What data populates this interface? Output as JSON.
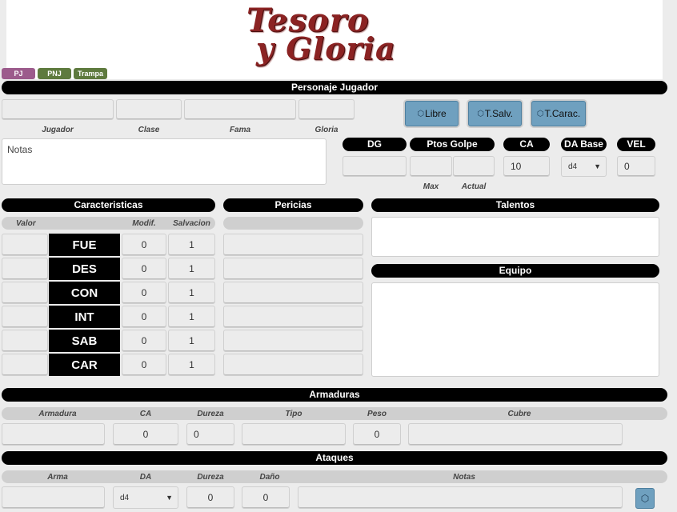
{
  "logo": {
    "line1": "Tesoro",
    "line2": "y Gloria"
  },
  "tabs": [
    {
      "label": "PJ",
      "color": "#9c5b8c"
    },
    {
      "label": "PNJ",
      "color": "#5e7a3e"
    },
    {
      "label": "Trampa",
      "color": "#5e7a3e"
    }
  ],
  "sections": {
    "character": "Personaje Jugador",
    "attributes": "Caracteristicas",
    "skills": "Pericias",
    "talents": "Talentos",
    "equipment": "Equipo",
    "armor": "Armaduras",
    "attacks": "Ataques"
  },
  "character": {
    "labels": {
      "player": "Jugador",
      "class": "Clase",
      "fame": "Fama",
      "glory": "Gloria"
    },
    "notes_placeholder": "Notas"
  },
  "rolls": {
    "free": "Libre",
    "saves": "T.Salv.",
    "attributes": "T.Carac."
  },
  "combat": {
    "dg_label": "DG",
    "hp_label": "Ptos Golpe",
    "hp_max_label": "Max",
    "hp_current_label": "Actual",
    "ca_label": "CA",
    "ca_value": "10",
    "da_label": "DA Base",
    "da_value": "d4",
    "vel_label": "VEL",
    "vel_value": "0"
  },
  "attribute_table": {
    "headers": {
      "value": "Valor",
      "mod": "Modif.",
      "save": "Salvacion"
    },
    "rows": [
      {
        "name": "FUE",
        "mod": "0",
        "save": "1"
      },
      {
        "name": "DES",
        "mod": "0",
        "save": "1"
      },
      {
        "name": "CON",
        "mod": "0",
        "save": "1"
      },
      {
        "name": "INT",
        "mod": "0",
        "save": "1"
      },
      {
        "name": "SAB",
        "mod": "0",
        "save": "1"
      },
      {
        "name": "CAR",
        "mod": "0",
        "save": "1"
      }
    ]
  },
  "armor_table": {
    "headers": {
      "armor": "Armadura",
      "ca": "CA",
      "hardness": "Dureza",
      "type": "Tipo",
      "weight": "Peso",
      "covers": "Cubre"
    },
    "row": {
      "ca": "0",
      "hardness": "0",
      "weight": "0"
    }
  },
  "attack_table": {
    "headers": {
      "weapon": "Arma",
      "da": "DA",
      "hardness": "Dureza",
      "damage": "Daño",
      "notes": "Notas"
    },
    "row": {
      "da": "d4",
      "hardness": "0",
      "damage": "0"
    }
  },
  "colors": {
    "header": "#000000",
    "roll_button": "#6fa0bf",
    "logo": "#8b2323"
  }
}
